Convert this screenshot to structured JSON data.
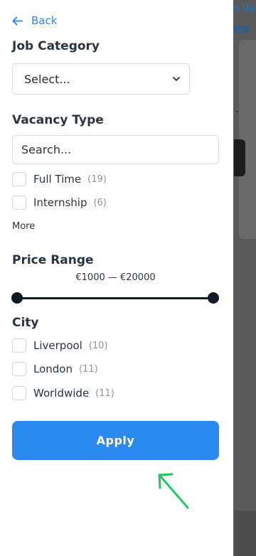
{
  "background": {
    "signup_text": "n Up",
    "heading_text": "es"
  },
  "back": {
    "label": "Back",
    "icon": "arrow-left-icon"
  },
  "job_category": {
    "title": "Job Category",
    "selected": "Select..."
  },
  "vacancy_type": {
    "title": "Vacancy Type",
    "search_placeholder": "Search...",
    "options": [
      {
        "label": "Full Time",
        "count": "(19)"
      },
      {
        "label": "Internship",
        "count": "(6)"
      }
    ],
    "more_label": "More"
  },
  "price_range": {
    "title": "Price Range",
    "display": "€1000 — €20000",
    "min": 1000,
    "max": 20000,
    "low_value": 1000,
    "high_value": 20000
  },
  "city": {
    "title": "City",
    "options": [
      {
        "label": "Liverpool",
        "count": "(10)"
      },
      {
        "label": "London",
        "count": "(11)"
      },
      {
        "label": "Worldwide",
        "count": "(11)"
      }
    ]
  },
  "apply": {
    "label": "Apply"
  },
  "colors": {
    "accent": "#2a8af0",
    "link": "#2a86e8",
    "annotation": "#22c55e"
  }
}
